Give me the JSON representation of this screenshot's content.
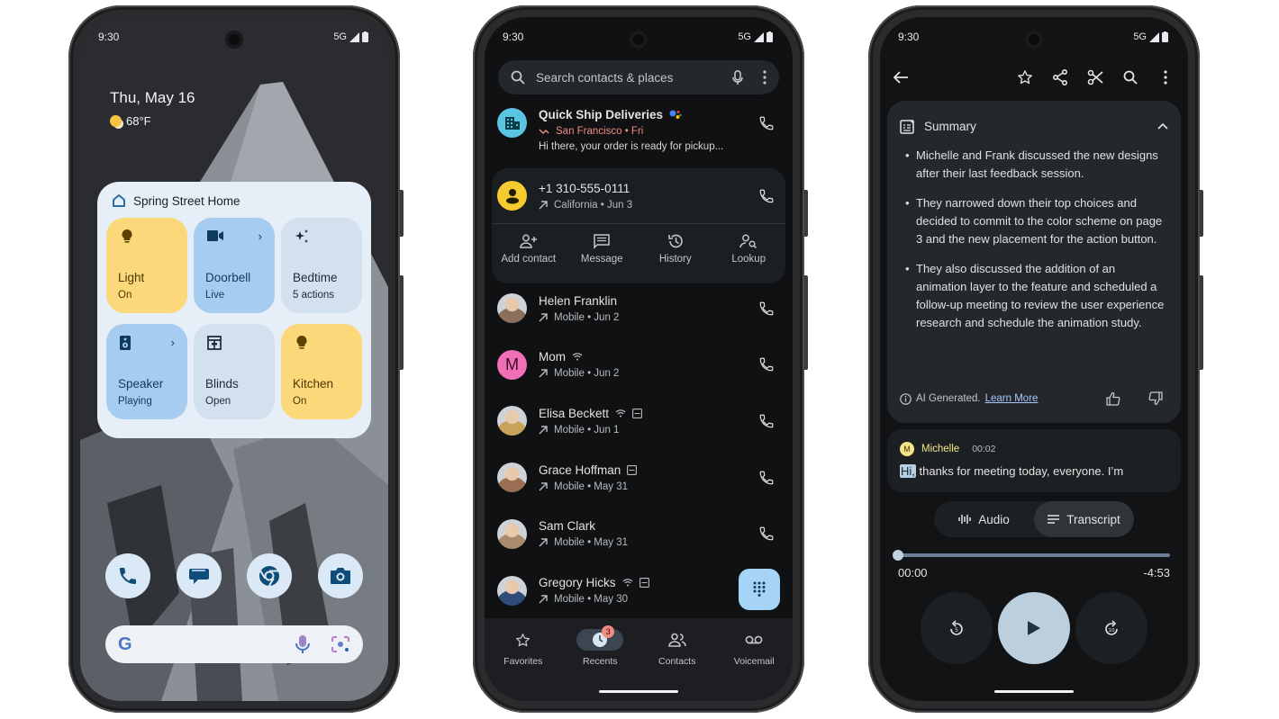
{
  "phones": [
    {
      "status": {
        "time": "9:30",
        "network": "5G"
      },
      "home": {
        "date": "Thu, May 16",
        "weather": {
          "icon": "partly-sunny-icon",
          "temp": "68°F"
        },
        "widget": {
          "title": "Spring Street Home",
          "tiles": [
            {
              "label": "Light",
              "status": "On",
              "icon": "lightbulb-icon",
              "style": "yellow",
              "has_chevron": false
            },
            {
              "label": "Doorbell",
              "status": "Live",
              "icon": "videocam-icon",
              "style": "blue",
              "has_chevron": true
            },
            {
              "label": "Bedtime",
              "status": "5 actions",
              "icon": "sparkle-icon",
              "style": "grey",
              "has_chevron": false
            },
            {
              "label": "Speaker",
              "status": "Playing",
              "icon": "speaker-icon",
              "style": "blue",
              "has_chevron": true
            },
            {
              "label": "Blinds",
              "status": "Open",
              "icon": "blinds-icon",
              "style": "grey",
              "has_chevron": false
            },
            {
              "label": "Kitchen",
              "status": "On",
              "icon": "lightbulb-icon",
              "style": "yellow",
              "has_chevron": false
            }
          ]
        },
        "dock": [
          "phone-icon",
          "messages-icon",
          "chrome-icon",
          "camera-icon"
        ],
        "search": {
          "logo": "G"
        }
      }
    },
    {
      "status": {
        "time": "9:30",
        "network": "5G"
      },
      "dialer": {
        "search_placeholder": "Search contacts & places",
        "business": {
          "name": "Quick Ship Deliveries",
          "meta": "San Francisco • Fri",
          "snippet": "Hi there, your order is ready for pickup..."
        },
        "expanded": {
          "number": "+1 310-555-0111",
          "meta": "California • Jun 3",
          "actions": [
            {
              "label": "Add contact",
              "icon": "add-person-icon"
            },
            {
              "label": "Message",
              "icon": "message-icon"
            },
            {
              "label": "History",
              "icon": "history-icon"
            },
            {
              "label": "Lookup",
              "icon": "person-search-icon"
            }
          ]
        },
        "calls": [
          {
            "name": "Helen Franklin",
            "meta": "Mobile • Jun 2",
            "avatar": "photo",
            "color": "#8a6f5c",
            "wifi": false,
            "rtt": false
          },
          {
            "name": "Mom",
            "meta": "Mobile • Jun 2",
            "avatar": "M",
            "color": "#f06fb6",
            "wifi": true,
            "rtt": false
          },
          {
            "name": "Elisa Beckett",
            "meta": "Mobile • Jun 1",
            "avatar": "photo",
            "color": "#c9a25a",
            "wifi": true,
            "rtt": true
          },
          {
            "name": "Grace Hoffman",
            "meta": "Mobile • May 31",
            "avatar": "photo",
            "color": "#9a6e52",
            "wifi": false,
            "rtt": true
          },
          {
            "name": "Sam Clark",
            "meta": "Mobile • May 31",
            "avatar": "photo",
            "color": "#a88a6d",
            "wifi": false,
            "rtt": false
          },
          {
            "name": "Gregory Hicks",
            "meta": "Mobile • May 30",
            "avatar": "photo",
            "color": "#2f4b78",
            "wifi": true,
            "rtt": true
          }
        ],
        "nav": [
          {
            "label": "Favorites",
            "icon": "star-icon",
            "active": false
          },
          {
            "label": "Recents",
            "icon": "recents-icon",
            "active": true,
            "badge": "3"
          },
          {
            "label": "Contacts",
            "icon": "contacts-icon",
            "active": false
          },
          {
            "label": "Voicemail",
            "icon": "voicemail-icon",
            "active": false
          }
        ]
      }
    },
    {
      "status": {
        "time": "9:30",
        "network": "5G"
      },
      "recorder": {
        "summary": {
          "title": "Summary",
          "bullets": [
            "Michelle and Frank discussed the new designs after their last feedback session.",
            "They narrowed down their top choices and decided to commit to the color scheme on page 3 and the new placement for the action button.",
            "They also discussed the addition of an animation layer to the feature and scheduled a follow-up meeting to review the user experience research and schedule the animation study."
          ],
          "ai_note": "AI Generated.",
          "learn_more": "Learn More"
        },
        "transcript": {
          "speaker_initial": "M",
          "speaker": "Michelle",
          "timestamp": "00:02",
          "highlight": "Hi,",
          "text": " thanks for meeting today, everyone. I’m"
        },
        "tabs": [
          {
            "label": "Audio",
            "active": false
          },
          {
            "label": "Transcript",
            "active": true
          }
        ],
        "player": {
          "elapsed": "00:00",
          "remaining": "-4:53",
          "progress": 0.0,
          "rewind_seconds": "5",
          "forward_seconds": "10"
        }
      }
    }
  ]
}
